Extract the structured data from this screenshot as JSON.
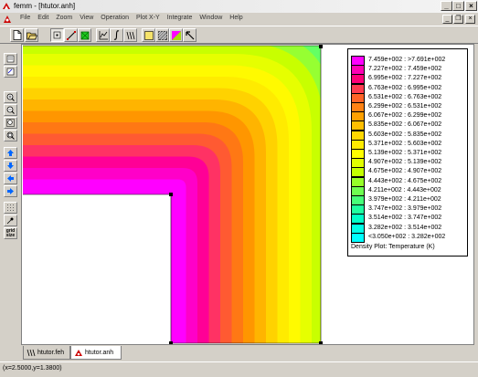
{
  "window": {
    "title": "femm - [htutor.anh]",
    "controls": {
      "minimize": "_",
      "maximize": "□",
      "close": "×"
    }
  },
  "menu": [
    "File",
    "Edit",
    "Zoom",
    "View",
    "Operation",
    "Plot X-Y",
    "Integrate",
    "Window",
    "Help"
  ],
  "mdi_controls": {
    "minimize": "_",
    "restore": "❐",
    "close": "×"
  },
  "toolbar": {
    "buttons": [
      "new-file-icon",
      "open-folder-icon",
      "point-mode-icon",
      "contour-mode-icon",
      "area-mode-icon",
      "plot-xy-icon",
      "integrate-icon",
      "block-integral-icon",
      "show-mesh-icon",
      "show-density-icon",
      "show-vectors-icon",
      "select-arrow-icon"
    ],
    "pressed": [
      "point-mode-icon"
    ]
  },
  "sidebar": {
    "buttons": [
      "edit-icon",
      "notes-icon",
      "zoom-in-icon",
      "zoom-out-icon",
      "zoom-natural-icon",
      "zoom-window-icon",
      "pan-up-icon",
      "pan-down-icon",
      "pan-left-icon",
      "pan-right-icon",
      "grid-icon",
      "snap-icon",
      "grid-size-icon"
    ],
    "grid_size_label": "grid size"
  },
  "plot": {
    "type": "density-plot",
    "band_colors": [
      "#ff00ff",
      "#ff00c8",
      "#ff0096",
      "#ff3264",
      "#ff5a32",
      "#ff7814",
      "#ff9600",
      "#ffb400",
      "#ffd200",
      "#ffeb00",
      "#fffa00",
      "#e6ff00",
      "#c8ff00",
      "#96ff32",
      "#64ff64",
      "#3cff8c",
      "#14ffb4",
      "#00ffd2",
      "#00fff0",
      "#00ffff"
    ],
    "legend": [
      {
        "color": "#ff00ff",
        "label": "7.459e+002 : >7.691e+002"
      },
      {
        "color": "#ff00b4",
        "label": "7.227e+002 : 7.459e+002"
      },
      {
        "color": "#ff0078",
        "label": "6.995e+002 : 7.227e+002"
      },
      {
        "color": "#ff3c50",
        "label": "6.763e+002 : 6.995e+002"
      },
      {
        "color": "#ff6428",
        "label": "6.531e+002 : 6.763e+002"
      },
      {
        "color": "#ff8214",
        "label": "6.299e+002 : 6.531e+002"
      },
      {
        "color": "#ffa000",
        "label": "6.067e+002 : 6.299e+002"
      },
      {
        "color": "#ffbe00",
        "label": "5.835e+002 : 6.067e+002"
      },
      {
        "color": "#ffd700",
        "label": "5.603e+002 : 5.835e+002"
      },
      {
        "color": "#ffeb00",
        "label": "5.371e+002 : 5.603e+002"
      },
      {
        "color": "#ffff00",
        "label": "5.139e+002 : 5.371e+002"
      },
      {
        "color": "#e1ff00",
        "label": "4.907e+002 : 5.139e+002"
      },
      {
        "color": "#c3ff00",
        "label": "4.675e+002 : 4.907e+002"
      },
      {
        "color": "#96ff28",
        "label": "4.443e+002 : 4.675e+002"
      },
      {
        "color": "#6eff50",
        "label": "4.211e+002 : 4.443e+002"
      },
      {
        "color": "#46ff78",
        "label": "3.979e+002 : 4.211e+002"
      },
      {
        "color": "#1effa0",
        "label": "3.747e+002 : 3.979e+002"
      },
      {
        "color": "#00ffc8",
        "label": "3.514e+002 : 3.747e+002"
      },
      {
        "color": "#00ffe6",
        "label": "3.282e+002 : 3.514e+002"
      },
      {
        "color": "#00ffff",
        "label": "<3.050e+002 : 3.282e+002"
      }
    ],
    "legend_caption": "Density Plot: Temperature (K)"
  },
  "tabs": [
    {
      "label": "htutor.feh",
      "icon": "mesh-doc-icon",
      "active": false
    },
    {
      "label": "htutor.anh",
      "icon": "result-doc-icon",
      "active": true
    }
  ],
  "status": {
    "text": "(x=2.5000,y=1.3800)"
  }
}
